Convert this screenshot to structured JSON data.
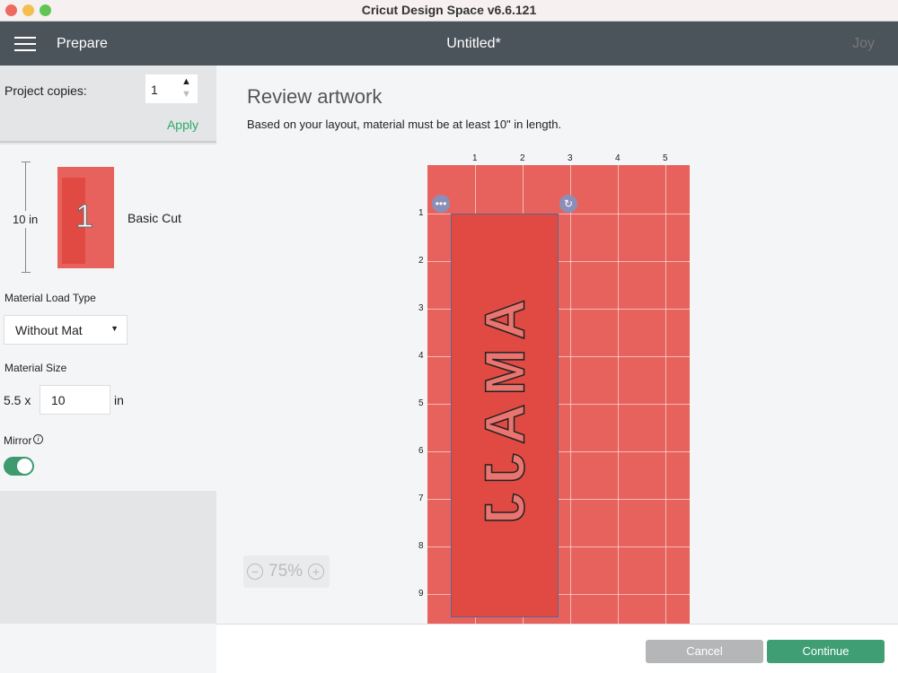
{
  "window": {
    "title": "Cricut Design Space  v6.6.121"
  },
  "header": {
    "section": "Prepare",
    "title": "Untitled*",
    "user": "Joy"
  },
  "sidebar": {
    "copies_label": "Project copies:",
    "copies_value": "1",
    "apply": "Apply",
    "mat_length": "10 in",
    "mat_number": "1",
    "mat_mode": "Basic Cut",
    "load_type_label": "Material Load Type",
    "load_type_value": "Without Mat",
    "size_label": "Material Size",
    "size_width": "5.5 x",
    "size_length": "10",
    "size_unit": "in",
    "mirror_label": "Mirror",
    "mirror_on": true
  },
  "main": {
    "title": "Review artwork",
    "subtitle": "Based on your layout, material must be at least 10\" in length.",
    "x_ticks": [
      "1",
      "2",
      "3",
      "4",
      "5"
    ],
    "y_ticks": [
      "1",
      "2",
      "3",
      "4",
      "5",
      "6",
      "7",
      "8",
      "9"
    ],
    "design_text": "AMAJJ",
    "zoom": "75%",
    "mat_color": "#e8625d"
  },
  "footer": {
    "cancel": "Cancel",
    "continue": "Continue"
  }
}
